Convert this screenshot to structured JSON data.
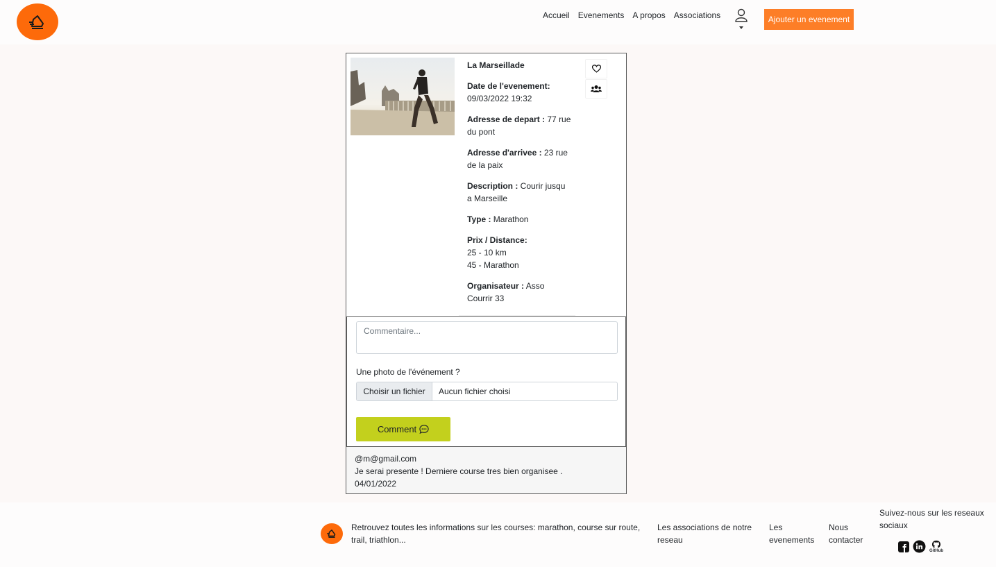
{
  "header": {
    "nav": [
      "Accueil",
      "Evenements",
      "A propos",
      "Associations"
    ],
    "add_event_label": "Ajouter un evenement"
  },
  "event": {
    "title": "La Marseillade",
    "date_label": "Date de l'evenement:",
    "date_value": "09/03/2022 19:32",
    "start_label": "Adresse de depart :",
    "start_value": " 77 rue du pont",
    "end_label": "Adresse d'arrivee :",
    "end_value": " 23 rue de la paix",
    "description_label": "Description :",
    "description_value": " Courir jusqu a Marseille",
    "type_label": "Type :",
    "type_value": " Marathon",
    "prices_label": "Prix / Distance:",
    "prices": [
      "25 - 10 km",
      "45 - Marathon"
    ],
    "organizer_label": "Organisateur :",
    "organizer_value": " Asso Courrir 33"
  },
  "comment_form": {
    "placeholder": "Commentaire...",
    "photo_label": "Une photo de l'événement ?",
    "file_button": "Choisir un fichier",
    "file_status": "Aucun fichier choisi",
    "submit_label": "Comment"
  },
  "comment": {
    "author": "@m@gmail.com",
    "text": "Je serai presente ! Derniere course tres bien organisee .",
    "date": "04/01/2022"
  },
  "footer": {
    "tagline": "Retrouvez toutes les informations sur les courses: marathon, course sur route, trail, triathlon...",
    "link_associations": "Les associations de notre reseau",
    "link_events": "Les evenements",
    "link_contact": "Nous contacter",
    "social_title": "Suivez-nous sur les reseaux sociaux",
    "github_text": "GitHub"
  },
  "colors": {
    "brand_orange": "#fd6a0a",
    "button_orange": "#fd7e27",
    "comment_green": "#c3d01d"
  }
}
